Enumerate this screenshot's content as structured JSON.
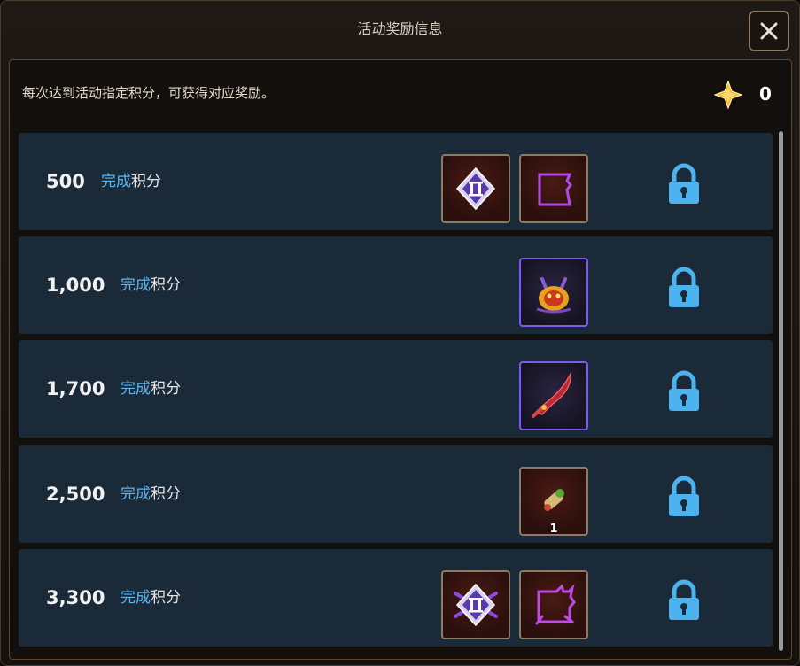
{
  "window": {
    "title": "活动奖励信息"
  },
  "header": {
    "info_text": "每次达到活动指定积分，可获得对应奖励。",
    "points": "0"
  },
  "rows": [
    {
      "score": "500",
      "label_highlight": "完成",
      "label_rest": "积分",
      "rewards": [
        "rank-2-badge-icon",
        "purple-frame-icon"
      ],
      "status": "locked"
    },
    {
      "score": "1,000",
      "label_highlight": "完成",
      "label_rest": "积分",
      "rewards": [
        "demon-mask-icon"
      ],
      "status": "locked"
    },
    {
      "score": "1,700",
      "label_highlight": "完成",
      "label_rest": "积分",
      "rewards": [
        "crimson-blade-icon"
      ],
      "status": "locked"
    },
    {
      "score": "2,500",
      "label_highlight": "完成",
      "label_rest": "积分",
      "rewards": [
        {
          "icon": "scroll-icon",
          "quantity": "1"
        }
      ],
      "status": "locked"
    },
    {
      "score": "3,300",
      "label_highlight": "完成",
      "label_rest": "积分",
      "rewards": [
        "rank-2-winged-badge-icon",
        "flame-frame-icon"
      ],
      "status": "locked"
    }
  ],
  "colors": {
    "accent_blue": "#5bb4f0",
    "row_bg": "#1b2a38",
    "epic_border": "#7a5af0",
    "gold": "#f5b52a"
  }
}
